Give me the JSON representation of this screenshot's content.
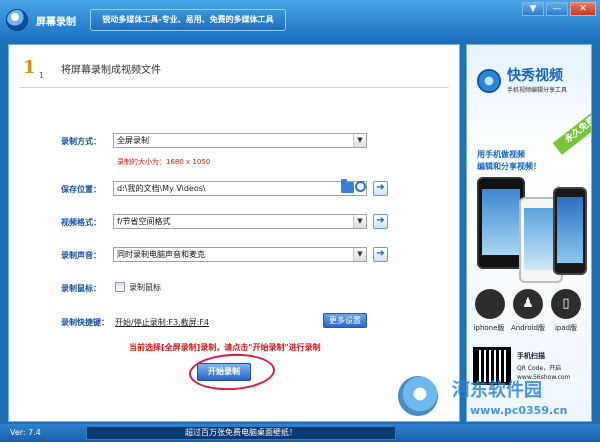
{
  "window": {
    "title": "屏幕录制",
    "slogan": "锐动多媒体工具-专业、易用、免费的多媒体工具",
    "menu_icon": "▼",
    "minimize_icon": "—",
    "close_icon": "✕"
  },
  "step": {
    "number": "1",
    "sub": "1",
    "title": "将屏幕录制成视频文件"
  },
  "form": {
    "record_mode": {
      "label": "录制方式：",
      "value": "全屏录制",
      "size_note": "录制的大小为：1680 x 1050"
    },
    "save_location": {
      "label": "保存位置：",
      "value": "d:\\我的文档\\My Videos\\"
    },
    "video_format": {
      "label": "视频格式：",
      "value": "f/节省空间格式"
    },
    "audio": {
      "label": "录制声音：",
      "value": "同时录制电脑声音和麦克"
    },
    "mouse": {
      "label": "录制鼠标：",
      "checkbox_label": "录制鼠标",
      "checked": false
    },
    "hotkeys": {
      "label": "录制快捷键：",
      "value": "开始/停止录制:F3,截屏:F4"
    },
    "more_settings_label": "更多设置",
    "hint": "当前选择[全屏录制]录制，请点击\"开始录制\"进行录制",
    "start_label": "开始录制",
    "dropdown_arrow": "▼",
    "go_arrow": "➔"
  },
  "ad": {
    "brand": "快秀视频",
    "tagline": "手机视频编辑分享工具",
    "ribbon": "永久免费",
    "promo_line1": "用手机做视频",
    "promo_line2": "编辑和分享视频！",
    "platforms": [
      {
        "label": "iphone版",
        "glyph": ""
      },
      {
        "label": "Android版",
        "glyph": "♟"
      },
      {
        "label": "ipad版",
        "glyph": "▯"
      }
    ],
    "qr_line1": "手机扫描",
    "qr_line2": "QR Code，开启",
    "qr_line3": "www.56show.com"
  },
  "watermark": {
    "name": "河东软件园",
    "url": "www.pc0359.cn"
  },
  "status": {
    "version": "Ver: 7.4",
    "banner": "超过百万张免费电脑桌面壁纸！"
  },
  "colors": {
    "accent": "#1f6fb5",
    "label_blue": "#1a4fa0",
    "warning_red": "#d01a1a",
    "step_orange": "#e28a17"
  }
}
